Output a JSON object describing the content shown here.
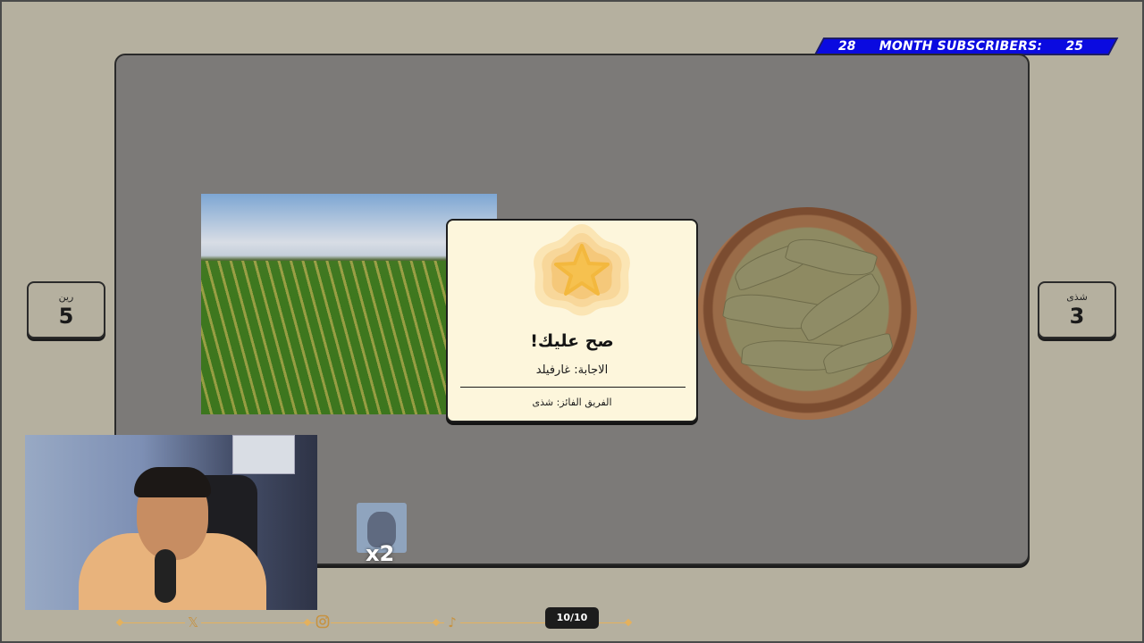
{
  "banner": {
    "left_count": "28",
    "label": "MONTH SUBSCRIBERS:",
    "right_count": "25"
  },
  "teams": {
    "left": {
      "name": "رين",
      "score": "5"
    },
    "right": {
      "name": "شذى",
      "score": "3"
    }
  },
  "result_modal": {
    "title": "صح عليك!",
    "answer": "الاجابة: غارفيلد",
    "winner": "الفريق الفائز: شذى",
    "badge_icon": "star-icon"
  },
  "powerup": {
    "multiplier": "x2"
  },
  "footer": {
    "counter": "10/10",
    "social_icons": [
      "x-icon",
      "instagram-icon",
      "tiktok-icon"
    ],
    "accent_color": "#e4b15d"
  },
  "colors": {
    "banner": "#0a0ae0",
    "modal_bg": "#fdf6dc",
    "background": "#b5b09f"
  }
}
